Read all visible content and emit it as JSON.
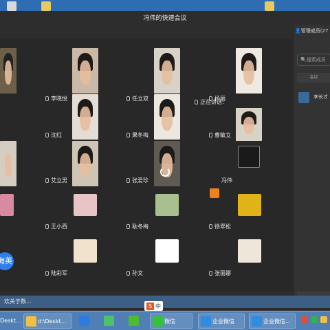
{
  "meeting": {
    "title": "冯伟的快速会议",
    "speaking_label": "正在讲话:"
  },
  "sidebar": {
    "header": "管理成员(27",
    "search_placeholder": "搜索成员",
    "section": "会议",
    "member": "李长才"
  },
  "participants": [
    {
      "name": "李晓悦"
    },
    {
      "name": "任立双"
    },
    {
      "name": "杨丽"
    },
    {
      "name": "沈红"
    },
    {
      "name": "果冬梅"
    },
    {
      "name": "曹敏立"
    },
    {
      "name": "艾立男"
    },
    {
      "name": "张爱珍"
    },
    {
      "name": "冯伟"
    },
    {
      "name": "王小西"
    },
    {
      "name": "耿冬梅"
    },
    {
      "name": "徐翠松"
    },
    {
      "name": "陆彩军"
    },
    {
      "name": "孙文"
    },
    {
      "name": "张丽娜"
    }
  ],
  "partial": {
    "call_button": "海英"
  },
  "status": {
    "text": "欢关于数..."
  },
  "taskbar": {
    "items": [
      "Deskt...",
      "d:\\Deskt...",
      "微信",
      "企业微信",
      "企业微信..."
    ]
  },
  "ime": {
    "label": "中"
  },
  "colors": {
    "accent": "#2f7ef0",
    "window_bg": "#2d2d2d",
    "taskbar": "#4f7fb5"
  }
}
